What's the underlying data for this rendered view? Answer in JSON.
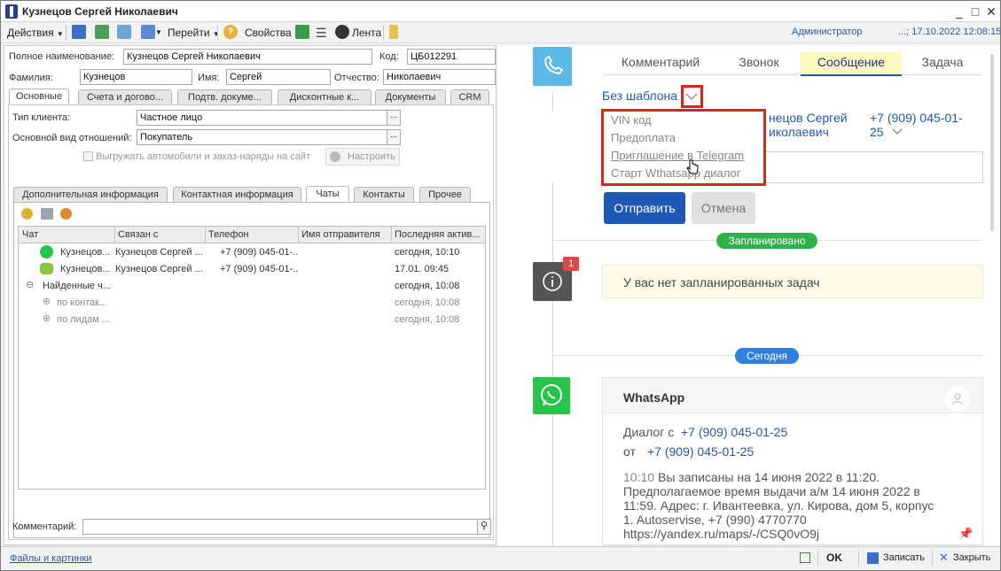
{
  "window": {
    "title": "Кузнецов Сергей Николаевич",
    "controls": [
      "_",
      "□",
      "✕"
    ]
  },
  "toolbar": {
    "actions_label": "Действия",
    "goto_label": "Перейти",
    "props_label": "Свойства",
    "feed_label": "Лента",
    "user": "Администратор",
    "session": "...; 17.10.2022 12:08:15"
  },
  "form": {
    "full_name_label": "Полное наименование:",
    "full_name": "Кузнецов Сергей Николаевич",
    "code_label": "Код:",
    "code": "ЦБ012291",
    "surname_label": "Фамилия:",
    "surname": "Кузнецов",
    "name_label": "Имя:",
    "name": "Сергей",
    "patronymic_label": "Отчество:",
    "patronymic": "Николаевич",
    "tabs": [
      "Основные",
      "Счета и догово...",
      "Подтв. докуме...",
      "Дисконтные к...",
      "Документы",
      "CRM"
    ],
    "client_type_label": "Тип клиента:",
    "client_type": "Частное лицо",
    "relation_label": "Основной вид отношений:",
    "relation": "Покупатель",
    "export_label": "Выгружать автомобили и заказ-наряды на сайт",
    "setup_label": "Настроить",
    "subtabs": [
      "Дополнительная информация",
      "Контактная информация",
      "Чаты",
      "Контакты",
      "Прочее"
    ],
    "grid": {
      "columns": [
        "Чат",
        "Связан с",
        "Телефон",
        "Имя отправителя",
        "Последняя актив..."
      ],
      "rows": [
        {
          "chat": "Кузнецов...",
          "linked": "Кузнецов Сергей ...",
          "phone": "+7 (909) 045-01-...",
          "sender": "",
          "last": "сегодня, 10:10",
          "icon": "whatsapp"
        },
        {
          "chat": "Кузнецов...",
          "linked": "Кузнецов Сергей ...",
          "phone": "+7 (909) 045-01-...",
          "sender": "",
          "last": "17.01. 09:45",
          "icon": "chat"
        },
        {
          "chat": "Найденные ч...",
          "linked": "",
          "phone": "",
          "sender": "",
          "last": "сегодня, 10:08",
          "icon": "minus"
        },
        {
          "chat": "по контак...",
          "linked": "",
          "phone": "",
          "sender": "",
          "last": "сегодня, 10:08",
          "icon": "plus"
        },
        {
          "chat": "по лидам ...",
          "linked": "",
          "phone": "",
          "sender": "",
          "last": "сегодня, 10:08",
          "icon": "plus"
        }
      ]
    },
    "comment_label": "Комментарий:"
  },
  "crm": {
    "tabs": [
      "Комментарий",
      "Звонок",
      "Сообщение",
      "Задача"
    ],
    "template_label": "Без шаблона",
    "templates": [
      "VIN код",
      "Предоплата",
      "Приглашение в Telegram",
      "Старт Wthatsapp диалог"
    ],
    "contact_name": "Кузнецов Сергей Николаевич",
    "contact_name_visible_1": "нецов Сергей",
    "contact_name_visible_2": "иколаевич",
    "contact_phone_1": "+7 (909) 045-01-",
    "contact_phone_2": "25",
    "send_label": "Отправить",
    "cancel_label": "Отмена",
    "planned_label": "Запланировано",
    "badge_count": "1",
    "no_tasks": "У вас нет запланированных задач",
    "today_label": "Сегодня",
    "channel": "WhatsApp",
    "dialog_with_label": "Диалог с",
    "dialog_with": "+7 (909) 045-01-25",
    "from_label": "от",
    "from": "+7 (909) 045-01-25",
    "msg_time": "10:10",
    "msg_lines": [
      "Вы записаны на 14 июня 2022 в 11:20.",
      "Предполагаемое время выдачи а/м 14 июня 2022 в",
      "11:59. Адрес: г. Ивантеевка, ул. Кирова, дом 5, корпус",
      "1. Autoservise, +7 (990) 4770770",
      "https://yandex.ru/maps/-/CSQ0vO9j"
    ],
    "colors": {
      "accent": "#1e5ab4",
      "green": "#2fb24c",
      "blue": "#2f7fe0",
      "whatsapp": "#25c44a",
      "highlight": "#d9261c"
    }
  },
  "status": {
    "files_label": "Файлы и картинки",
    "ok_label": "OK",
    "save_label": "Записать",
    "close_label": "Закрыть"
  }
}
